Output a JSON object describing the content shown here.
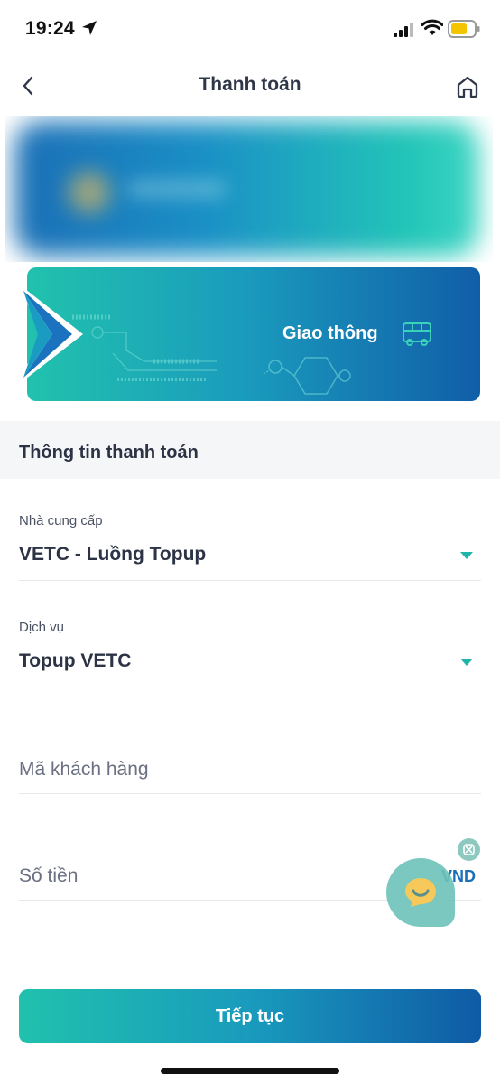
{
  "status_bar": {
    "time": "19:24",
    "icons": [
      "location-arrow-icon",
      "signal-icon",
      "wifi-icon",
      "battery-icon"
    ]
  },
  "header": {
    "title": "Thanh toán",
    "back_icon": "chevron-left-icon",
    "home_icon": "home-icon"
  },
  "category": {
    "label": "Giao thông",
    "icon": "bus-icon"
  },
  "section": {
    "title": "Thông tin thanh toán"
  },
  "form": {
    "provider": {
      "label": "Nhà cung cấp",
      "value": "VETC - Luồng Topup"
    },
    "service": {
      "label": "Dịch vụ",
      "value": "Topup VETC"
    },
    "customer_code": {
      "placeholder": "Mã khách hàng"
    },
    "amount": {
      "placeholder": "Số tiền",
      "currency": "VND"
    }
  },
  "chat": {
    "icon": "chat-smile-icon",
    "close_icon": "close-icon"
  },
  "actions": {
    "continue_label": "Tiếp tục"
  },
  "colors": {
    "accent_teal": "#20c1ad",
    "accent_blue": "#0f5aa5",
    "text_dark": "#2c3345",
    "section_bg": "#f5f6f8"
  }
}
